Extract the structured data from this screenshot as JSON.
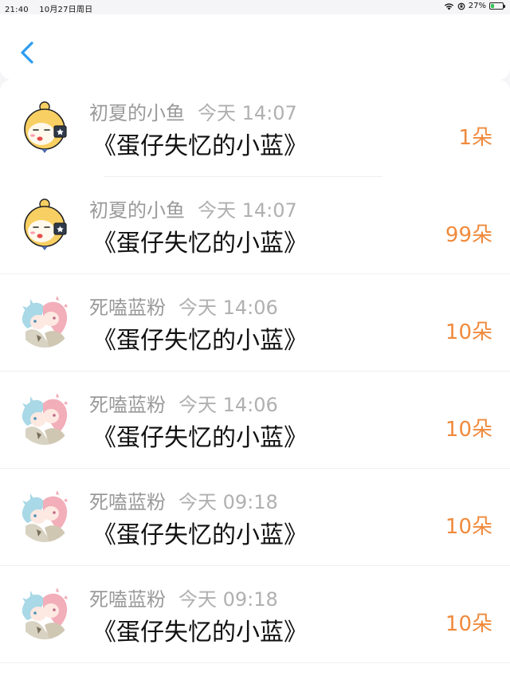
{
  "status_bar": {
    "time": "21:40",
    "date": "10月27日周日",
    "battery_percent": "27%",
    "battery_level": 0.27
  },
  "nav": {
    "back_icon": "chevron-left-icon"
  },
  "colors": {
    "accent": "#2d9cf0",
    "count": "#f08a3c"
  },
  "items": [
    {
      "name": "初夏的小鱼",
      "time": "今天 14:07",
      "title": "《蛋仔失忆的小蓝》",
      "count": "1朵",
      "avatar": "yellow-character-avatar"
    },
    {
      "name": "初夏的小鱼",
      "time": "今天 14:07",
      "title": "《蛋仔失忆的小蓝》",
      "count": "99朵",
      "avatar": "yellow-character-avatar"
    },
    {
      "name": "死嗑蓝粉",
      "time": "今天 14:06",
      "title": "《蛋仔失忆的小蓝》",
      "count": "10朵",
      "avatar": "anime-pair-avatar"
    },
    {
      "name": "死嗑蓝粉",
      "time": "今天 14:06",
      "title": "《蛋仔失忆的小蓝》",
      "count": "10朵",
      "avatar": "anime-pair-avatar"
    },
    {
      "name": "死嗑蓝粉",
      "time": "今天 09:18",
      "title": "《蛋仔失忆的小蓝》",
      "count": "10朵",
      "avatar": "anime-pair-avatar"
    },
    {
      "name": "死嗑蓝粉",
      "time": "今天 09:18",
      "title": "《蛋仔失忆的小蓝》",
      "count": "10朵",
      "avatar": "anime-pair-avatar"
    }
  ]
}
